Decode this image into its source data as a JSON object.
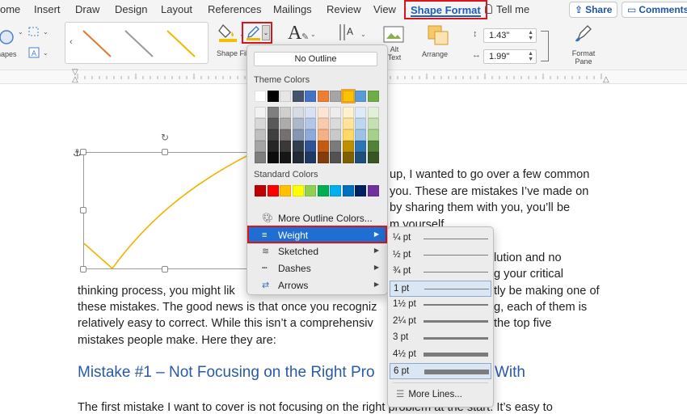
{
  "tabs": [
    "ome",
    "Insert",
    "Draw",
    "Design",
    "Layout",
    "References",
    "Mailings",
    "Review",
    "View",
    "Shape Format"
  ],
  "tell_me": "Tell me",
  "share_label": "Share",
  "comments_label": "Comments",
  "ribbon": {
    "shapes_label": "hapes",
    "shape_fill_label": "Shape Fill",
    "alt_text_label": "Alt Text",
    "arrange_label": "Arrange",
    "height_value": "1.43\"",
    "width_value": "1.99\"",
    "format_pane_label": "Format Pane"
  },
  "outline_menu": {
    "no_outline": "No Outline",
    "theme_colors_label": "Theme Colors",
    "standard_colors_label": "Standard Colors",
    "theme_columns": [
      "#ffffff",
      "#000000",
      "#e7e6e6",
      "#44546a",
      "#4472c4",
      "#ed7d31",
      "#a5a5a5",
      "#ffc000",
      "#5b9bd5",
      "#70ad47"
    ],
    "theme_tints": [
      [
        "#f2f2f2",
        "#7f7f7f",
        "#d0cece",
        "#d6dce4",
        "#d9e2f3",
        "#fbe5d5",
        "#ededed",
        "#fff2cc",
        "#deebf6",
        "#e2efd9"
      ],
      [
        "#d8d8d8",
        "#595959",
        "#aeabab",
        "#adb9ca",
        "#b4c6e7",
        "#f7cbac",
        "#dbdbdb",
        "#fee599",
        "#bdd7ee",
        "#c5e0b3"
      ],
      [
        "#bfbfbf",
        "#3f3f3f",
        "#757070",
        "#8496b0",
        "#8eaadb",
        "#f4b183",
        "#c9c9c9",
        "#ffd966",
        "#9cc3e5",
        "#a8d08d"
      ],
      [
        "#a5a5a5",
        "#262626",
        "#3a3838",
        "#323f4f",
        "#2f5496",
        "#c55a11",
        "#7b7b7b",
        "#bf9000",
        "#2e75b5",
        "#538135"
      ],
      [
        "#7f7f7f",
        "#0c0c0c",
        "#171616",
        "#222a35",
        "#1f3864",
        "#833c0b",
        "#525252",
        "#7f6000",
        "#1e4e79",
        "#375623"
      ]
    ],
    "selected_theme_color": "#ffc000",
    "standard_colors": [
      "#c00000",
      "#ff0000",
      "#ffc000",
      "#ffff00",
      "#92d050",
      "#00b050",
      "#00b0f0",
      "#0070c0",
      "#002060",
      "#7030a0"
    ],
    "items": [
      {
        "label": "More Outline Colors...",
        "icon": "palette-icon"
      },
      {
        "label": "Weight",
        "icon": "line-weight-icon"
      },
      {
        "label": "Sketched",
        "icon": "sketched-line-icon"
      },
      {
        "label": "Dashes",
        "icon": "dashes-icon"
      },
      {
        "label": "Arrows",
        "icon": "arrows-icon"
      }
    ]
  },
  "weight_menu": {
    "options": [
      "¼ pt",
      "½ pt",
      "¾ pt",
      "1 pt",
      "1½ pt",
      "2¼ pt",
      "3 pt",
      "4½ pt",
      "6 pt"
    ],
    "selected": [
      "1 pt",
      "6 pt"
    ],
    "more_lines": "More Lines..."
  },
  "document": {
    "lines": [
      "up, I wanted to go over a few common",
      "you. These are mistakes I’ve made on",
      "by sharing them with you, you’ll be",
      "m yourself.",
      "lution and no",
      "g your critical",
      "thinking process, you might lik",
      "tly be making one of",
      "these mistakes. The good news is that once you recogniz",
      "g, each of them is",
      "relatively easy to correct. While this isn’t a comprehensiv",
      "the top five",
      "mistakes people make. Here they are:",
      "The first mistake I want to cover is not focusing on the right problem at the start. It’s easy to"
    ],
    "heading_left": "Mistake #1 – Not Focusing on the Right Pro",
    "heading_right": "With"
  }
}
